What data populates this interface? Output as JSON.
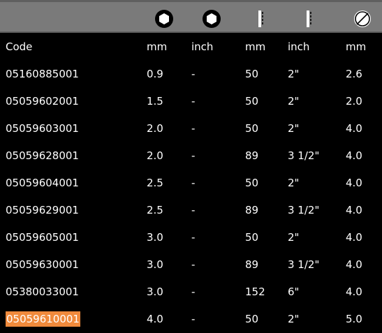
{
  "icons": [
    "hex-socket-icon",
    "hex-socket-icon",
    "blade-length-icon",
    "blade-length-icon",
    "diameter-icon"
  ],
  "colors": {
    "header_bar": "#7a7a7a",
    "background": "#000000",
    "highlight": "#f08a3c",
    "text": "#ffffff"
  },
  "table": {
    "headers": [
      "Code",
      "mm",
      "inch",
      "mm",
      "inch",
      "mm"
    ],
    "rows": [
      [
        "05160885001",
        "0.9",
        "-",
        "50",
        "2\"",
        "2.6"
      ],
      [
        "05059602001",
        "1.5",
        "-",
        "50",
        "2\"",
        "2.0"
      ],
      [
        "05059603001",
        "2.0",
        "-",
        "50",
        "2\"",
        "4.0"
      ],
      [
        "05059628001",
        "2.0",
        "-",
        "89",
        "3 1/2\"",
        "4.0"
      ],
      [
        "05059604001",
        "2.5",
        "-",
        "50",
        "2\"",
        "4.0"
      ],
      [
        "05059629001",
        "2.5",
        "-",
        "89",
        "3 1/2\"",
        "4.0"
      ],
      [
        "05059605001",
        "3.0",
        "-",
        "50",
        "2\"",
        "4.0"
      ],
      [
        "05059630001",
        "3.0",
        "-",
        "89",
        "3 1/2\"",
        "4.0"
      ],
      [
        "05380033001",
        "3.0",
        "-",
        "152",
        "6\"",
        "4.0"
      ],
      [
        "05059610001",
        "4.0",
        "-",
        "50",
        "2\"",
        "5.0"
      ]
    ],
    "highlighted_code": "05059610001"
  }
}
